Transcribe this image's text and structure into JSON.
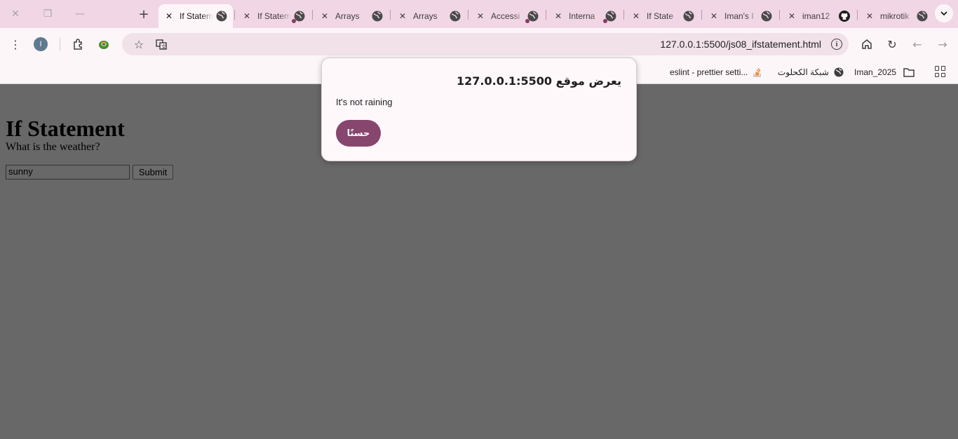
{
  "browser": {
    "tabs": [
      {
        "title": "If Statem",
        "active": true
      },
      {
        "title": "If Statem",
        "active": false,
        "audio": true
      },
      {
        "title": "Arrays",
        "active": false
      },
      {
        "title": "Arrays",
        "active": false
      },
      {
        "title": "Accessi",
        "active": false,
        "audio": true
      },
      {
        "title": "Interna",
        "active": false,
        "audio": true
      },
      {
        "title": "If State",
        "active": false
      },
      {
        "title": "Iman's I",
        "active": false
      },
      {
        "title": "iman12",
        "active": false,
        "icon": "github-icon"
      },
      {
        "title": "mikrotik",
        "active": false
      }
    ],
    "profile_initial": "I",
    "url": "127.0.0.1:5500/js08_ifstatement.html",
    "bookmarks": {
      "eslint": "eslint - prettier setti...",
      "arabic_net": "شبكة الكحلوت",
      "folder": "Iman_2025"
    }
  },
  "page": {
    "heading": "If Statement",
    "question": "What is the weather?",
    "input_value": "sunny",
    "submit_label": "Submit"
  },
  "dialog": {
    "title": "يعرض موقع 127.0.0.1:5500",
    "message": "It's not raining",
    "ok_label": "حسنًا"
  },
  "colors": {
    "tabstrip": "#f1d6e6",
    "toolbar": "#fdf6f9",
    "page_overlay": "#686868",
    "dialog_button": "#86466e"
  }
}
